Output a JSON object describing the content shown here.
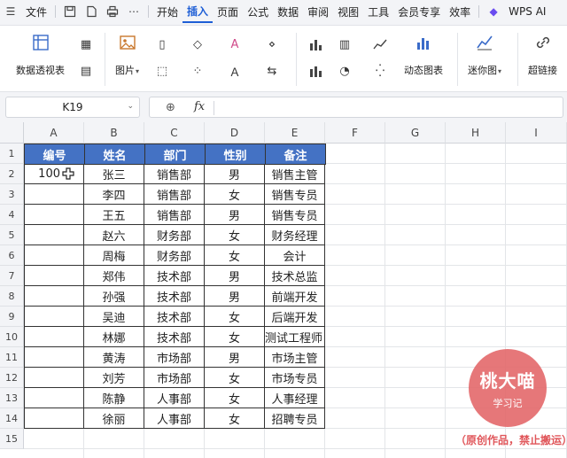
{
  "menubar": {
    "file_label": "文件",
    "tabs": [
      "开始",
      "插入",
      "页面",
      "公式",
      "数据",
      "审阅",
      "视图",
      "工具",
      "会员专享",
      "效率"
    ],
    "active_tab": "插入",
    "wps_ai_label": "WPS AI"
  },
  "ribbon": {
    "pivot_table_label": "数据透视表",
    "picture_label": "图片",
    "dynamic_chart_label": "动态图表",
    "sparkline_label": "迷你图",
    "hyperlink_label": "超链接"
  },
  "formula_bar": {
    "name_box": "K19",
    "fx_label": "fx",
    "formula_value": ""
  },
  "sheet": {
    "columns": [
      "A",
      "B",
      "C",
      "D",
      "E",
      "F",
      "G",
      "H",
      "I"
    ],
    "rows": [
      "1",
      "2",
      "3",
      "4",
      "5",
      "6",
      "7",
      "8",
      "9",
      "10",
      "11",
      "12",
      "13",
      "14",
      "15"
    ],
    "headers": [
      "编号",
      "姓名",
      "部门",
      "性别",
      "备注"
    ],
    "data": [
      [
        "100",
        "张三",
        "销售部",
        "男",
        "销售主管"
      ],
      [
        "",
        "李四",
        "销售部",
        "女",
        "销售专员"
      ],
      [
        "",
        "王五",
        "销售部",
        "男",
        "销售专员"
      ],
      [
        "",
        "赵六",
        "财务部",
        "女",
        "财务经理"
      ],
      [
        "",
        "周梅",
        "财务部",
        "女",
        "会计"
      ],
      [
        "",
        "郑伟",
        "技术部",
        "男",
        "技术总监"
      ],
      [
        "",
        "孙强",
        "技术部",
        "男",
        "前端开发"
      ],
      [
        "",
        "吴迪",
        "技术部",
        "女",
        "后端开发"
      ],
      [
        "",
        "林娜",
        "技术部",
        "女",
        "测试工程师"
      ],
      [
        "",
        "黄涛",
        "市场部",
        "男",
        "市场主管"
      ],
      [
        "",
        "刘芳",
        "市场部",
        "女",
        "市场专员"
      ],
      [
        "",
        "陈静",
        "人事部",
        "女",
        "人事经理"
      ],
      [
        "",
        "徐丽",
        "人事部",
        "女",
        "招聘专员"
      ]
    ]
  },
  "watermark": {
    "title": "桃大喵",
    "subtitle": "学习记",
    "note": "（原创作品，禁止搬运）"
  },
  "colors": {
    "header_fill": "#4472c4",
    "accent": "#1f5fd6",
    "watermark": "#e46c6e"
  }
}
